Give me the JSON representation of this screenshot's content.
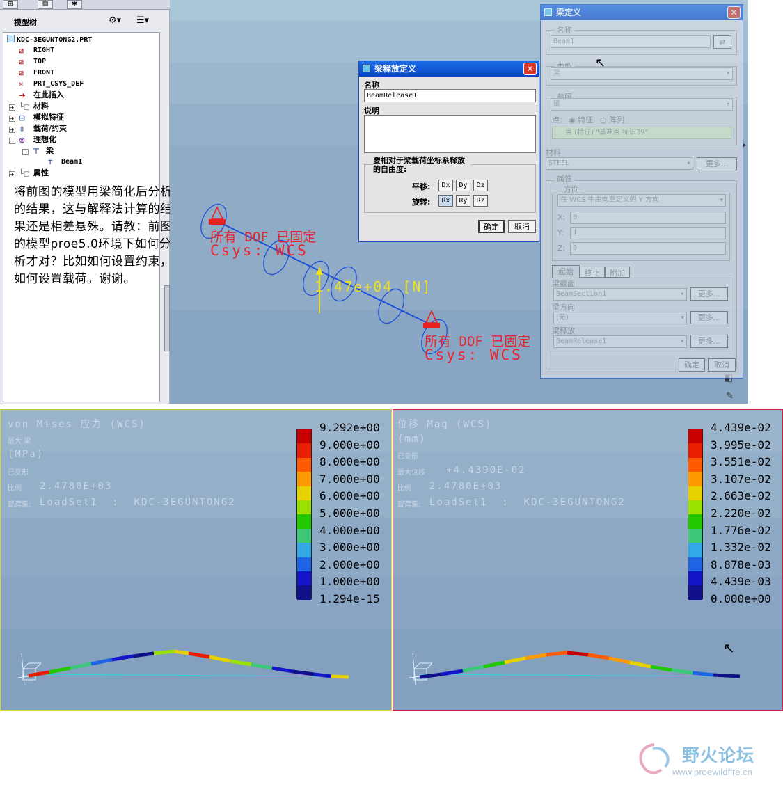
{
  "tree": {
    "header": "模型树",
    "items": [
      {
        "label": "KDC-3EGUNTONG2.PRT"
      },
      {
        "label": "RIGHT"
      },
      {
        "label": "TOP"
      },
      {
        "label": "FRONT"
      },
      {
        "label": "PRT_CSYS_DEF"
      },
      {
        "label": "在此插入"
      },
      {
        "label": "材料"
      },
      {
        "label": "模拟特征"
      },
      {
        "label": "载荷/约束"
      },
      {
        "label": "理想化"
      },
      {
        "label": "梁"
      },
      {
        "label": "Beam1"
      },
      {
        "label": "属性"
      }
    ]
  },
  "note": "将前图的模型用梁简化后分析的结果，这与解释法计算的结果还是相差悬殊。请教：前图的模型proe5.0环境下如何分析才对？比如如何设置约束，如何设置载荷。谢谢。",
  "viewport": {
    "dof1": "所有 DOF 已固定",
    "csys1": "Csys: WCS",
    "load": "1.47e+04 [N]",
    "dof2": "所有 DOF 已固定",
    "csys2": "Csys: WCS"
  },
  "release_dialog": {
    "title": "梁释放定义",
    "name_label": "名称",
    "name_value": "BeamRelease1",
    "desc_label": "说明",
    "group_label": "要相对于梁载荷坐标系释放的自由度:",
    "translate_label": "平移:",
    "rotate_label": "旋转:",
    "dx": "Dx",
    "dy": "Dy",
    "dz": "Dz",
    "rx": "Rx",
    "ry": "Ry",
    "rz": "Rz",
    "ok": "确定",
    "cancel": "取消"
  },
  "beam_dialog": {
    "title": "梁定义",
    "name_label": "名称",
    "name_value": "Beam1",
    "type_label": "类型",
    "type_value": "梁",
    "ref_label": "参照",
    "ref_value": "链",
    "point_label": "点：",
    "opt_feature": "特征",
    "opt_array": "阵列",
    "point_value": "点 (特征) \"基准点 标识39\"",
    "material_label": "材料",
    "material_value": "STEEL",
    "more": "更多...",
    "props_label": "属性",
    "dir_label": "方向",
    "dir_value": "在 WCS 中由向量定义的 Y 方向",
    "x_label": "X:",
    "x_value": "0",
    "y_label": "Y:",
    "y_value": "1",
    "z_label": "Z:",
    "z_value": "0",
    "tab_start": "起始",
    "tab_end": "终止",
    "tab_add": "附加",
    "section_label": "梁截面",
    "section_value": "BeamSection1",
    "orient_label": "梁方向",
    "orient_value": "(无)",
    "release_label": "梁释放",
    "release_value": "BeamRelease1",
    "ok": "确定",
    "cancel": "取消"
  },
  "stress": {
    "l1": "von Mises 应力 (WCS)",
    "l2": "最大 梁",
    "l3": "(MPa)",
    "l4": "已变形",
    "l5_label": "比例",
    "l5_value": "2.4780E+03",
    "l6_label": "载荷集:",
    "l6_value": "LoadSet1  :  KDC-3EGUNTONG2",
    "legend": [
      "9.292e+00",
      "9.000e+00",
      "8.000e+00",
      "7.000e+00",
      "6.000e+00",
      "5.000e+00",
      "4.000e+00",
      "3.000e+00",
      "2.000e+00",
      "1.000e+00",
      "1.294e-15"
    ]
  },
  "disp": {
    "l1": "位移 Mag (WCS)",
    "l2": "(mm)",
    "l3": "已变形",
    "l4_label": "最大位移",
    "l4_value": "+4.4390E-02",
    "l5_label": "比例",
    "l5_value": "2.4780E+03",
    "l6_label": "载荷集:",
    "l6_value": "LoadSet1  :  KDC-3EGUNTONG2",
    "legend": [
      "4.439e-02",
      "3.995e-02",
      "3.551e-02",
      "3.107e-02",
      "2.663e-02",
      "2.220e-02",
      "1.776e-02",
      "1.332e-02",
      "8.878e-03",
      "4.439e-03",
      "0.000e+00"
    ]
  },
  "colors": {
    "legend": [
      "#c80000",
      "#e81e00",
      "#ff5a00",
      "#ff9a00",
      "#e6d200",
      "#9ae000",
      "#22c800",
      "#3cc878",
      "#32a8e6",
      "#1e64e6",
      "#1414c8",
      "#10108a"
    ]
  },
  "watermark": {
    "name": "野火论坛",
    "url": "www.proewildfire.cn"
  }
}
